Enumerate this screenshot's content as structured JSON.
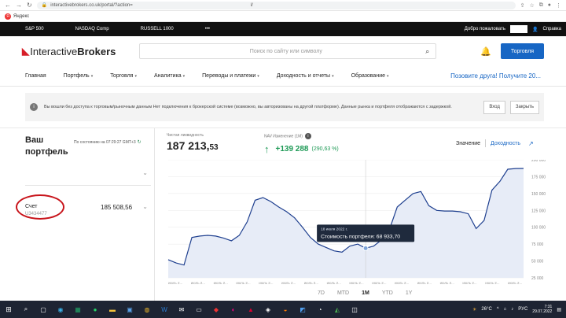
{
  "browser": {
    "url": "interactivebrokers.co.uk/portal/?action=",
    "url_tail": "l/",
    "bookmark": "Яндекс",
    "yandex_glyph": "Я"
  },
  "ticker": {
    "items": [
      "S&P 500",
      "NASDAQ Comp",
      "RUSSELL 1000",
      "•••"
    ],
    "welcome": "Добро пожаловать",
    "help": "Справка"
  },
  "header": {
    "logo_prefix": "Interactive",
    "logo_bold": "Brokers",
    "search_placeholder": "Поиск по сайту или символу",
    "trade_button": "Торговля"
  },
  "menu": {
    "items": [
      "Главная",
      "Портфель",
      "Торговля",
      "Аналитика",
      "Переводы и платежи",
      "Доходность и отчеты",
      "Образование"
    ],
    "invite": "Позовите друга! Получите 20..."
  },
  "notice": {
    "text": "Вы вошли без доступа к торговым/рыночным данным Нет подключения к брокерской системе (возможно, вы авторизованы на другой платформе). Данные рынка и портфеля отображаются с задержкой.",
    "login": "Вход",
    "close": "Закрыть"
  },
  "portfolio": {
    "title": "Ваш портфель",
    "as_of": "По состоянию на 07:29:27 GMT+3",
    "account_label": "Счет",
    "account_number": "U3434477",
    "account_value": "185 508,56",
    "net_liq_label": "Чистая ликвидность",
    "net_liq_int": "187 213,",
    "net_liq_dec": "53",
    "nav_change_label": "NAV Изменение (1M)",
    "nav_change": "+139 288",
    "nav_change_pct": "(290,63 %)",
    "toggle_value": "Значение",
    "toggle_return": "Доходность"
  },
  "colors": {
    "accent": "#1766c4",
    "positive": "#1e9a56",
    "ibRed": "#d71e28",
    "annotation": "#c8141b"
  },
  "chart_data": {
    "type": "area",
    "y": [
      52000,
      47000,
      44000,
      85000,
      87000,
      88000,
      87000,
      84000,
      80000,
      88000,
      108000,
      140000,
      144000,
      138000,
      130000,
      123000,
      114000,
      100000,
      85000,
      75000,
      70000,
      65000,
      63000,
      72000,
      75000,
      69000,
      72000,
      81000,
      96000,
      130000,
      140000,
      150000,
      153000,
      132000,
      125000,
      124000,
      124000,
      123000,
      120000,
      98000,
      110000,
      155000,
      168000,
      186000,
      187000,
      187200
    ],
    "ylim": [
      25000,
      200000
    ],
    "yticks": [
      "200 000",
      "175 000",
      "150 000",
      "125 000",
      "100 000",
      "75 000",
      "50 000",
      "25 000"
    ],
    "xticks": [
      "июль 2...",
      "июль 2...",
      "июль 2...",
      "июль 2...",
      "июль 2...",
      "июль 2...",
      "июль 2...",
      "июль 2...",
      "июль 2...",
      "июль 2...",
      "июль 2...",
      "июль 2...",
      "июль 2...",
      "июль 2...",
      "июль 2...",
      "июль 2..."
    ],
    "tooltip": {
      "date": "18 июля 2022 г.",
      "label": "Стоимость портфеля: 68 933,70",
      "value": 68933.7,
      "index": 25
    },
    "fill_color": "#e7ecf7",
    "line_color": "#1e3f8f",
    "ranges": [
      "7D",
      "MTD",
      "1M",
      "YTD",
      "1Y"
    ],
    "active_range": "1M"
  },
  "taskbar": {
    "weather": "26°C",
    "lang": "РУС",
    "time": "7:31",
    "date": "29.07.2022"
  }
}
